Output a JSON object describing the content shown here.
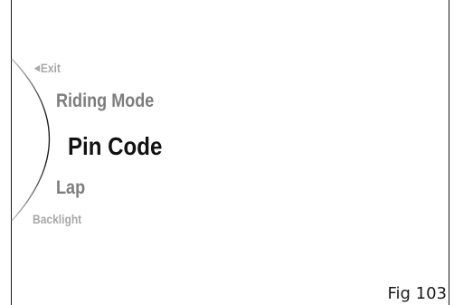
{
  "menu": {
    "exit_label": "Exit",
    "riding_mode_label": "Riding Mode",
    "pin_code_label": "Pin Code",
    "lap_label": "Lap",
    "backlight_label": "Backlight",
    "selected_item": "Pin Code"
  },
  "figure_label": "Fig 103",
  "colors": {
    "selected_text": "#111111",
    "adjacent_text": "#7d7d7d",
    "far_text": "#a8a8a8",
    "arc_line": "#1a1a1a",
    "arc_fade": "#bdbdbd"
  },
  "icons": {
    "exit_arrow": "triangle-left-icon"
  }
}
